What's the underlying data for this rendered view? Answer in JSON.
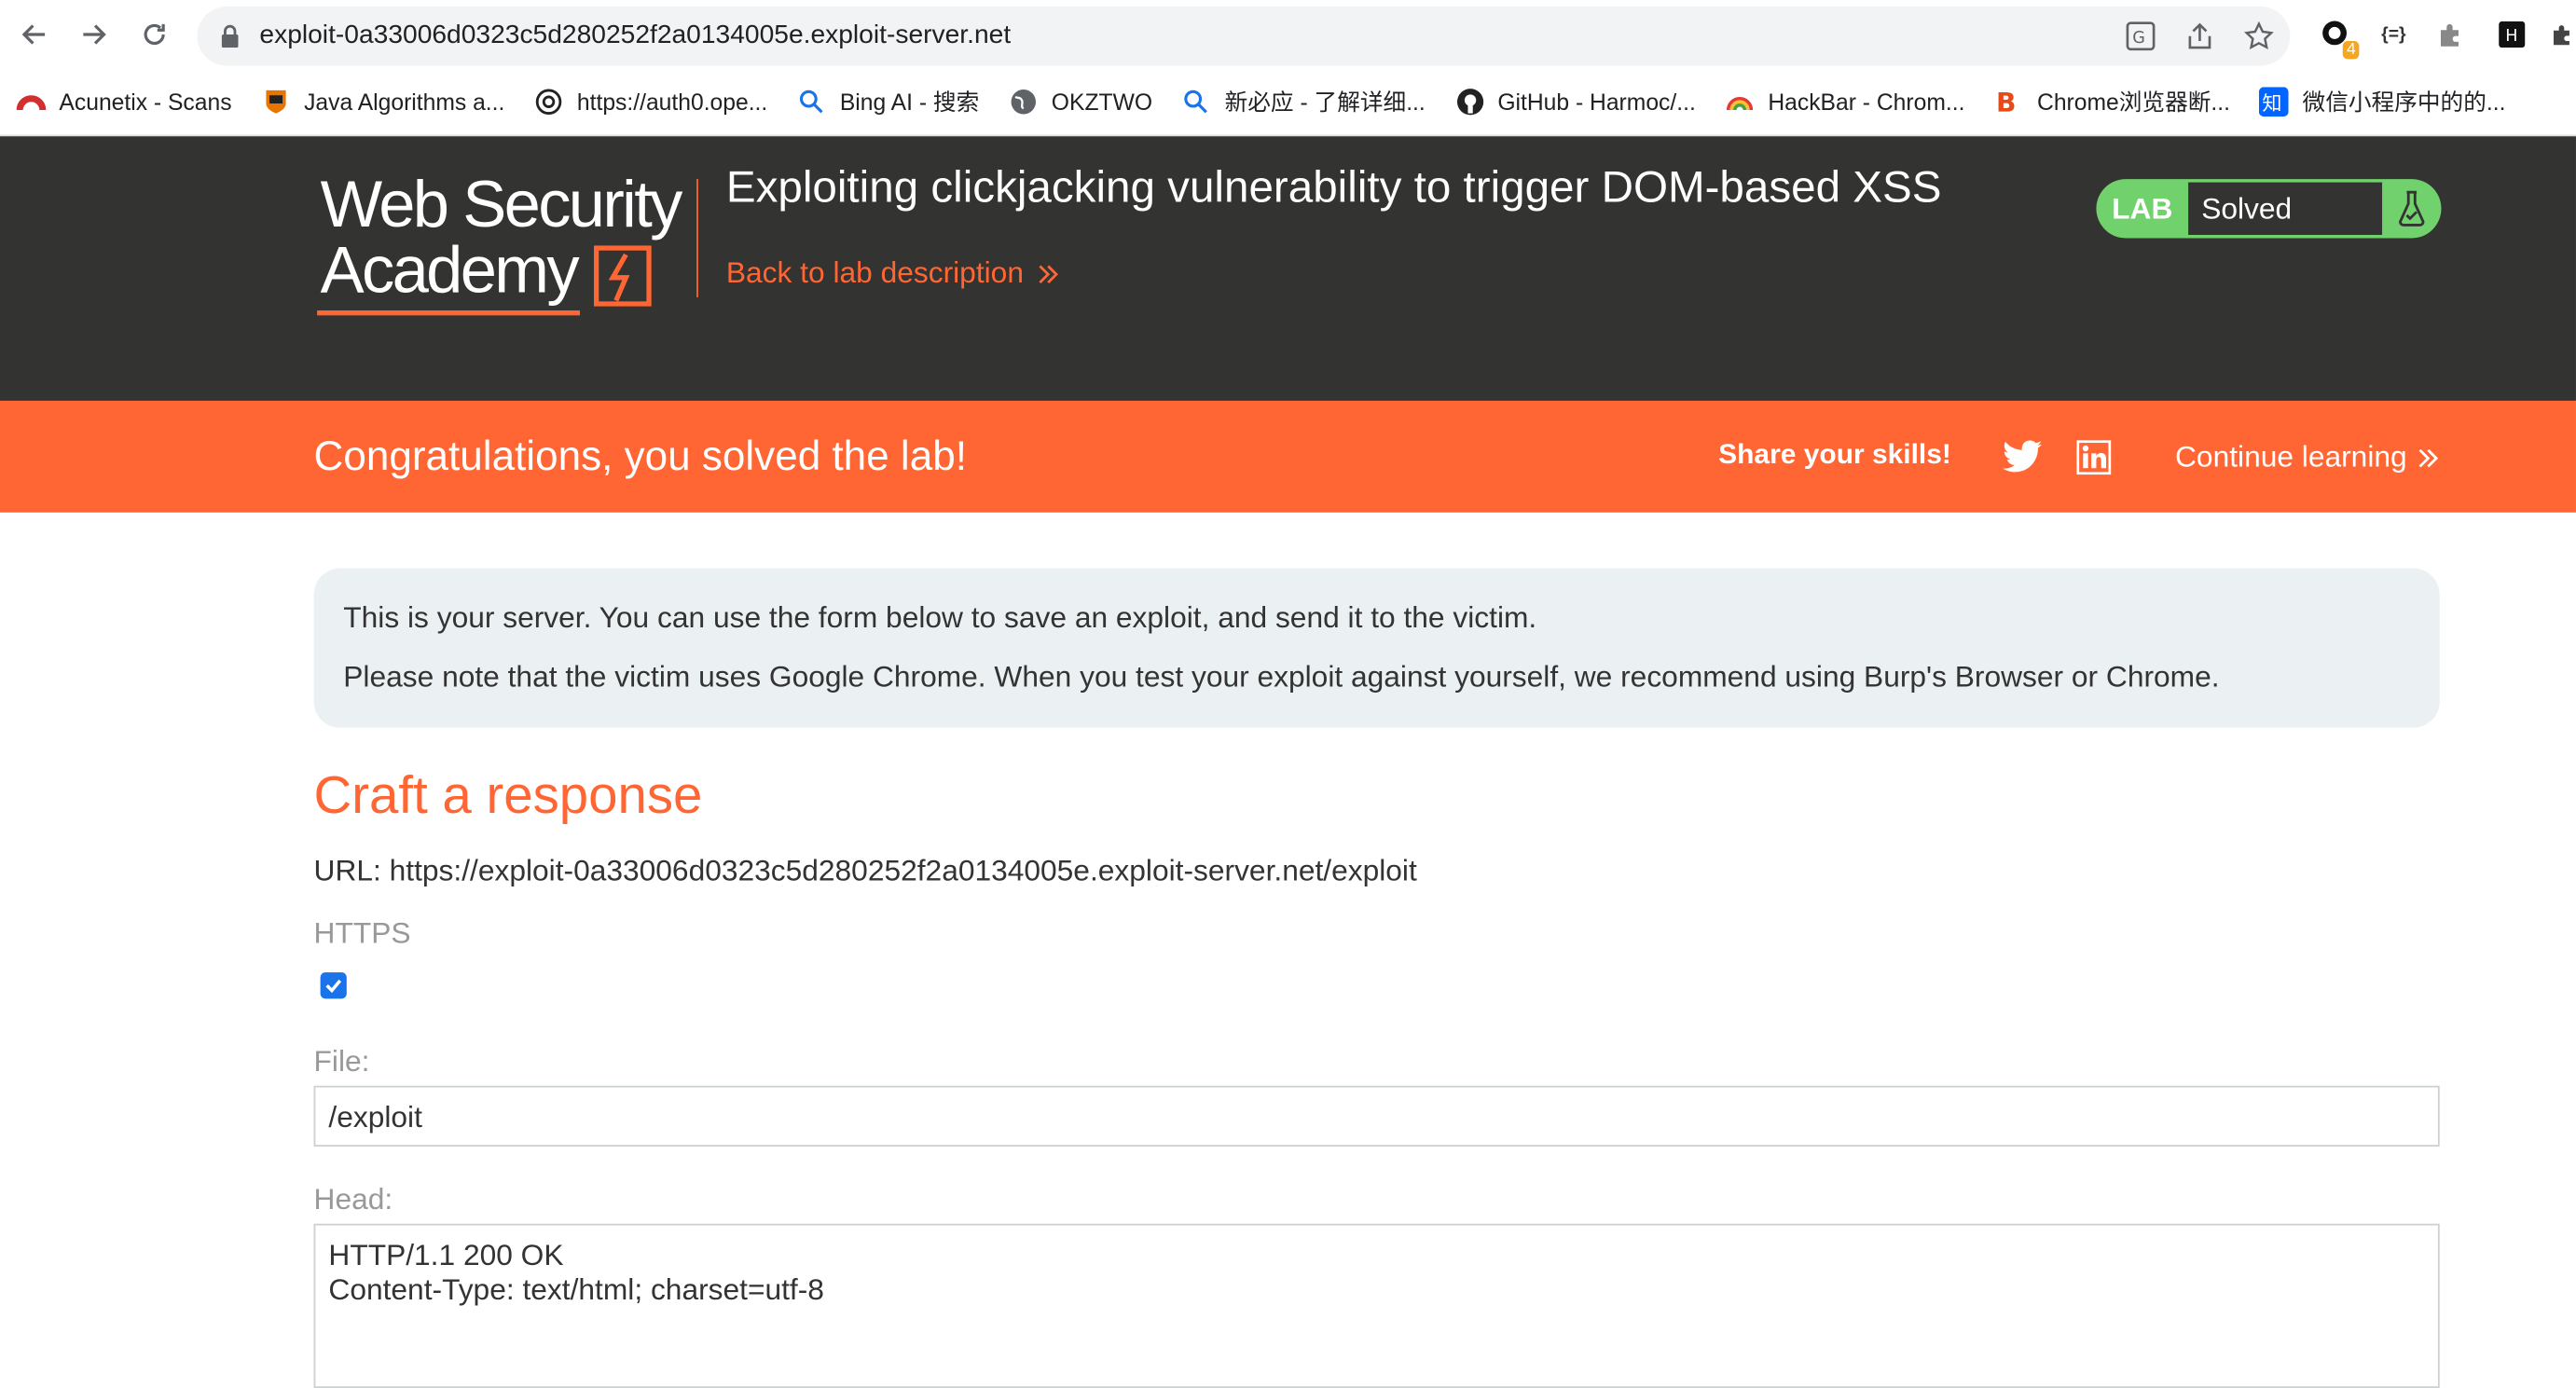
{
  "browser": {
    "url": "exploit-0a33006d0323c5d280252f2a0134005e.exploit-server.net",
    "extension_badge": "4",
    "bookmarks": [
      {
        "label": "Acunetix - Scans",
        "icon": "acunetix-icon"
      },
      {
        "label": "Java Algorithms a...",
        "icon": "princeton-icon"
      },
      {
        "label": "https://auth0.ope...",
        "icon": "openai-icon"
      },
      {
        "label": "Bing AI - 搜索",
        "icon": "search-icon"
      },
      {
        "label": "OKZTWO",
        "icon": "globe-icon"
      },
      {
        "label": "新必应 - 了解详细...",
        "icon": "search-icon"
      },
      {
        "label": "GitHub - Harmoc/...",
        "icon": "github-icon"
      },
      {
        "label": "HackBar - Chrom...",
        "icon": "hackbar-icon"
      },
      {
        "label": "Chrome浏览器断...",
        "icon": "b-icon"
      },
      {
        "label": "微信小程序中的的...",
        "icon": "zhihu-icon"
      }
    ]
  },
  "header": {
    "logo_line1": "Web Security",
    "logo_line2": "Academy",
    "title": "Exploiting clickjacking vulnerability to trigger DOM-based XSS",
    "back_link": "Back to lab description",
    "status_lab": "LAB",
    "status_text": "Solved"
  },
  "congrats": {
    "message": "Congratulations, you solved the lab!",
    "share": "Share your skills!",
    "continue": "Continue learning"
  },
  "server": {
    "info_line1": "This is your server. You can use the form below to save an exploit, and send it to the victim.",
    "info_line2": "Please note that the victim uses Google Chrome. When you test your exploit against yourself, we recommend using Burp's Browser or Chrome.",
    "craft_title": "Craft a response",
    "url_line": "URL: https://exploit-0a33006d0323c5d280252f2a0134005e.exploit-server.net/exploit",
    "https_label": "HTTPS",
    "https_checked": true,
    "file_label": "File:",
    "file_value": "/exploit",
    "head_label": "Head:",
    "head_value": "HTTP/1.1 200 OK\nContent-Type: text/html; charset=utf-8"
  },
  "colors": {
    "accent": "#ff6633",
    "header_bg": "#333332",
    "solved_green": "#70d16d",
    "info_bg": "#ebf0f2"
  }
}
